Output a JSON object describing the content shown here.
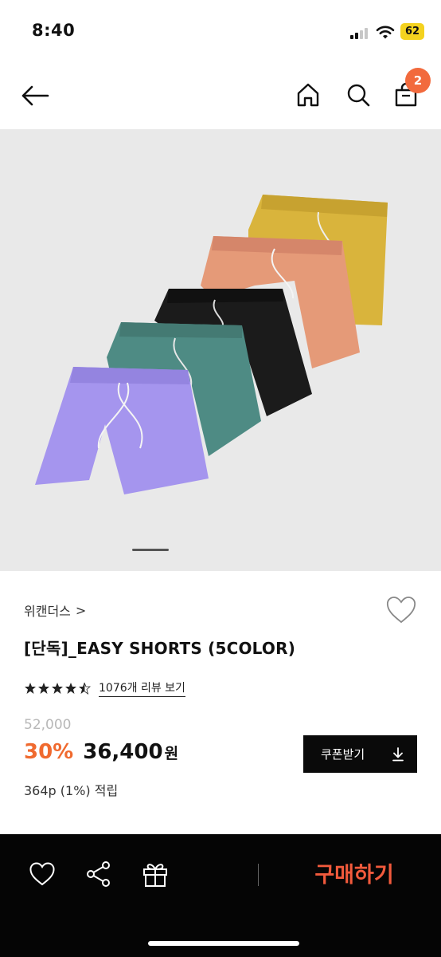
{
  "status_bar": {
    "time": "8:40",
    "battery": "62",
    "battery_color": "#f4d21f"
  },
  "header": {
    "icons": [
      "back-arrow-icon",
      "home-icon",
      "search-icon",
      "cart-icon"
    ],
    "cart_count": "2",
    "badge_color": "#f26a3d"
  },
  "gallery": {
    "colors": [
      {
        "name": "yellow",
        "hex": "#d9b43c"
      },
      {
        "name": "peach",
        "hex": "#e59a78"
      },
      {
        "name": "black",
        "hex": "#1b1b1b"
      },
      {
        "name": "teal",
        "hex": "#4e8b84"
      },
      {
        "name": "lavender",
        "hex": "#a595ee"
      }
    ],
    "active_slide": 1
  },
  "product": {
    "brand": "위캔더스",
    "brand_chevron": ">",
    "title": "[단독]_EASY SHORTS (5COLOR)",
    "rating": 4.5,
    "review_link": "1076개 리뷰 보기",
    "original_price": "52,000",
    "discount": "30%",
    "price": "36,400",
    "currency": "원",
    "points": "364p (1%) 적립",
    "coupon_label": "쿠폰받기",
    "accent_color": "#f06a2f"
  },
  "bottom_bar": {
    "icons": [
      "heart-icon",
      "share-icon",
      "gift-icon"
    ],
    "buy_label": "구매하기",
    "buy_color": "#f25a3c"
  }
}
